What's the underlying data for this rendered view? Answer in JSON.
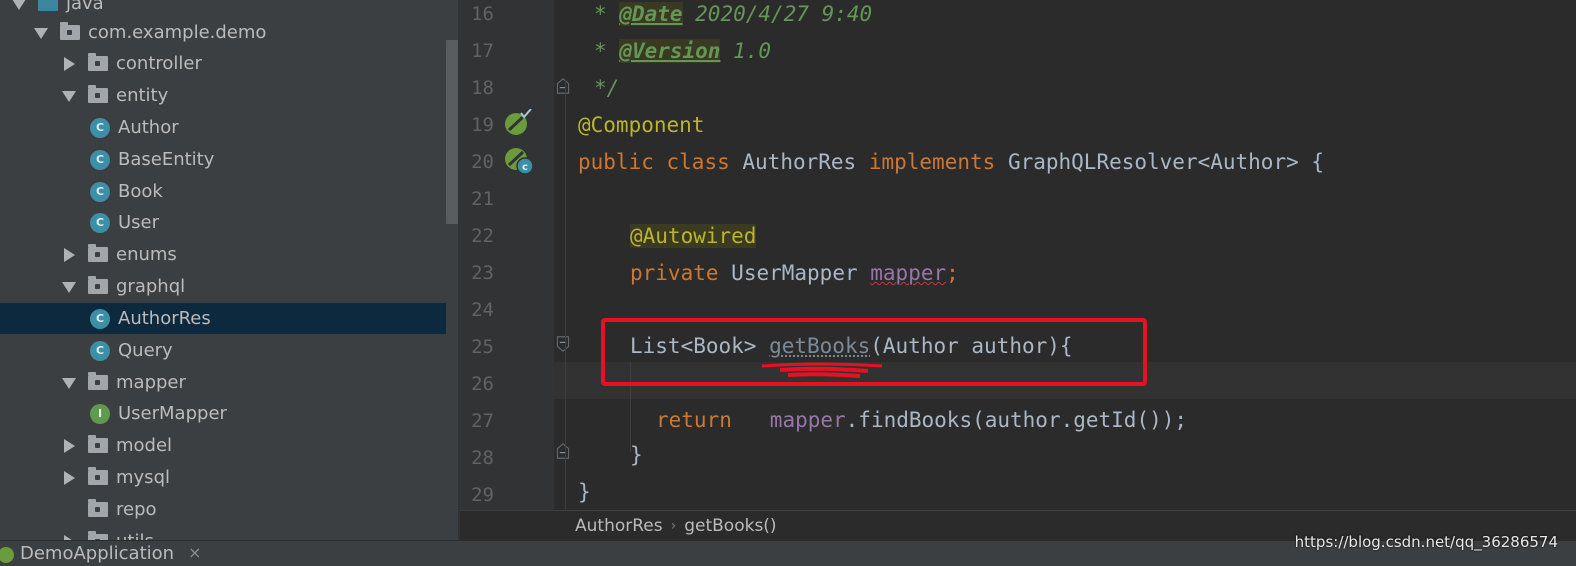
{
  "project_tree": {
    "items": [
      {
        "label": "java",
        "type": "src-folder",
        "expanded": true
      },
      {
        "label": "com.example.demo",
        "type": "package",
        "expanded": true
      },
      {
        "label": "controller",
        "type": "package",
        "expanded": false
      },
      {
        "label": "entity",
        "type": "package",
        "expanded": true
      },
      {
        "label": "Author",
        "type": "class",
        "icon_letter": "C"
      },
      {
        "label": "BaseEntity",
        "type": "class",
        "icon_letter": "C"
      },
      {
        "label": "Book",
        "type": "class",
        "icon_letter": "C"
      },
      {
        "label": "User",
        "type": "class",
        "icon_letter": "C"
      },
      {
        "label": "enums",
        "type": "package",
        "expanded": false
      },
      {
        "label": "graphql",
        "type": "package",
        "expanded": true
      },
      {
        "label": "AuthorRes",
        "type": "class",
        "icon_letter": "C",
        "selected": true
      },
      {
        "label": "Query",
        "type": "class",
        "icon_letter": "C"
      },
      {
        "label": "mapper",
        "type": "package",
        "expanded": true
      },
      {
        "label": "UserMapper",
        "type": "interface",
        "icon_letter": "I"
      },
      {
        "label": "model",
        "type": "package",
        "expanded": false
      },
      {
        "label": "mysql",
        "type": "package",
        "expanded": false
      },
      {
        "label": "repo",
        "type": "package"
      },
      {
        "label": "utils",
        "type": "package",
        "expanded": false
      }
    ]
  },
  "editor": {
    "line_numbers": [
      "16",
      "17",
      "18",
      "19",
      "20",
      "21",
      "22",
      "23",
      "24",
      "25",
      "26",
      "27",
      "28",
      "29"
    ],
    "comment": {
      "star": "* ",
      "date_tag": "@Date",
      "date_value": " 2020/4/27 9:40",
      "version_tag": "@Version",
      "version_value": " 1.0",
      "end": "*/"
    },
    "line19": {
      "annotation": "@Component"
    },
    "line20": {
      "kw_public": "public",
      "kw_class": "class",
      "class_name": "AuthorRes",
      "kw_implements": "implements",
      "interface": "GraphQLResolver<Author>",
      "brace": "{"
    },
    "line22": {
      "annotation": "@Autowired"
    },
    "line23": {
      "kw_private": "private",
      "type": "UserMapper",
      "field": "mapper",
      "semi": ";"
    },
    "line25": {
      "return_type": "List<Book>",
      "method": "getBooks",
      "params": "(Author author){"
    },
    "line27": {
      "kw_return": "return",
      "field": "mapper",
      "call": ".findBooks(author.getId());"
    },
    "line28": {
      "brace": "}"
    },
    "line29": {
      "brace": "}"
    }
  },
  "breadcrumb": {
    "class": "AuthorRes",
    "separator": "›",
    "method": "getBooks()"
  },
  "bottom_tab": {
    "label": "DemoApplication",
    "close": "×"
  },
  "watermark": "https://blog.csdn.net/qq_36286574",
  "colors": {
    "annotation": "#bbb529",
    "keyword": "#cc7832",
    "field": "#9876aa",
    "comment": "#629755",
    "highlight_box": "#e81123"
  }
}
